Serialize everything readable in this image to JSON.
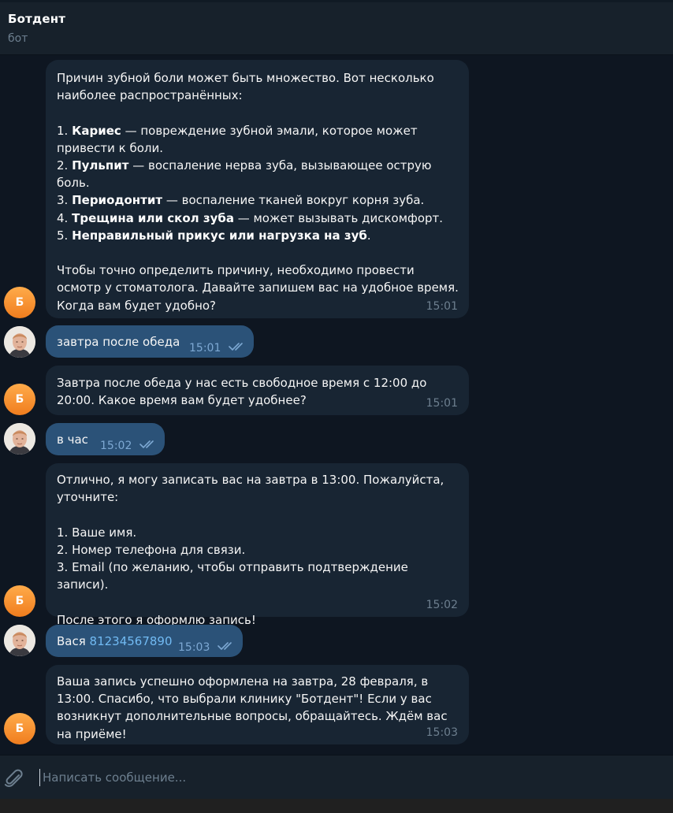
{
  "header": {
    "title": "Ботдент",
    "subtitle": "бот"
  },
  "bot_avatar_letter": "Б",
  "messages": [
    {
      "from": "bot",
      "time": "15:01",
      "paragraphs": [
        [
          "Причин зубной боли может быть множество. Вот несколько наиболее распространённых:"
        ],
        [],
        [
          "1. ",
          {
            "b": "Кариес"
          },
          " — повреждение зубной эмали, которое может привести к боли."
        ],
        [
          "2. ",
          {
            "b": "Пульпит"
          },
          " — воспаление нерва зуба, вызывающее острую боль."
        ],
        [
          "3. ",
          {
            "b": "Периодонтит"
          },
          " — воспаление тканей вокруг корня зуба."
        ],
        [
          "4. ",
          {
            "b": "Трещина или скол зуба"
          },
          " — может вызывать дискомфорт."
        ],
        [
          "5. ",
          {
            "b": "Неправильный прикус или нагрузка на зуб"
          },
          "."
        ],
        [],
        [
          "Чтобы точно определить причину, необходимо провести осмотр у стоматолога. Давайте запишем вас на удобное время. Когда вам будет удобно?"
        ]
      ]
    },
    {
      "from": "user",
      "time": "15:01",
      "text": "завтра после обеда"
    },
    {
      "from": "bot",
      "time": "15:01",
      "paragraphs": [
        [
          "Завтра после обеда у нас есть свободное время с 12:00 до 20:00. Какое время вам будет удобнее?"
        ]
      ]
    },
    {
      "from": "user",
      "time": "15:02",
      "text": "в час"
    },
    {
      "from": "bot",
      "time": "15:02",
      "paragraphs": [
        [
          "Отлично, я могу записать вас на завтра в 13:00. Пожалуйста, уточните:"
        ],
        [],
        [
          "1. Ваше имя."
        ],
        [
          "2. Номер телефона для связи."
        ],
        [
          "3. Email (по желанию, чтобы отправить подтверждение записи)."
        ],
        [],
        [
          "После этого я оформлю запись!"
        ]
      ]
    },
    {
      "from": "user",
      "time": "15:03",
      "text": "Вася ",
      "phone": "81234567890"
    },
    {
      "from": "bot",
      "time": "15:03",
      "paragraphs": [
        [
          "Ваша запись успешно оформлена на завтра, 28 февраля, в 13:00. Спасибо, что выбрали клинику \"Ботдент\"! Если у вас возникнут дополнительные вопросы, обращайтесь. Ждём вас на приёме!"
        ]
      ]
    }
  ],
  "composer": {
    "placeholder": "Написать сообщение..."
  },
  "icons": {
    "attach": "paperclip-icon",
    "read_status": "double-check-icon"
  },
  "colors": {
    "background": "#0e1621",
    "incoming_bubble": "#182533",
    "outgoing_bubble": "#2b5278",
    "header": "#17212b",
    "link": "#71baf3",
    "bot_avatar": "#f58a2c"
  }
}
